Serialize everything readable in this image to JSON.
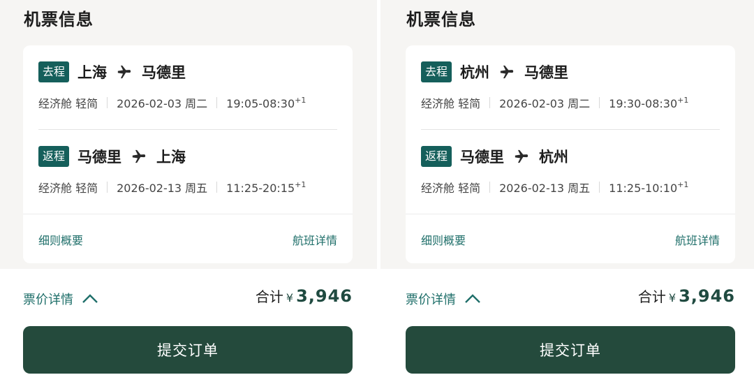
{
  "panels": [
    {
      "section_title": "机票信息",
      "outbound": {
        "tag": "去程",
        "from": "上海",
        "to": "马德里",
        "cabin": "经济舱 轻简",
        "date": "2026-02-03 周二",
        "time": "19:05-08:30",
        "day_offset": "+1"
      },
      "return": {
        "tag": "返程",
        "from": "马德里",
        "to": "上海",
        "cabin": "经济舱 轻简",
        "date": "2026-02-13 周五",
        "time": "11:25-20:15",
        "day_offset": "+1"
      },
      "rules_link": "细则概要",
      "flight_details_link": "航班详情",
      "price_details_link": "票价详情",
      "total_label": "合计",
      "currency": "¥",
      "total_amount": "3,946",
      "submit_label": "提交订单"
    },
    {
      "section_title": "机票信息",
      "outbound": {
        "tag": "去程",
        "from": "杭州",
        "to": "马德里",
        "cabin": "经济舱 轻简",
        "date": "2026-02-03 周二",
        "time": "19:30-08:30",
        "day_offset": "+1"
      },
      "return": {
        "tag": "返程",
        "from": "马德里",
        "to": "杭州",
        "cabin": "经济舱 轻简",
        "date": "2026-02-13 周五",
        "time": "11:25-10:10",
        "day_offset": "+1"
      },
      "rules_link": "细则概要",
      "flight_details_link": "航班详情",
      "price_details_link": "票价详情",
      "total_label": "合计",
      "currency": "¥",
      "total_amount": "3,946",
      "submit_label": "提交订单"
    }
  ],
  "colors": {
    "accent_teal": "#155f5b",
    "link_teal": "#1f6f6a",
    "button_dark_green": "#244a3c",
    "background": "#f6f5f3"
  },
  "icons": [
    "airplane-icon",
    "chevron-up-icon"
  ]
}
